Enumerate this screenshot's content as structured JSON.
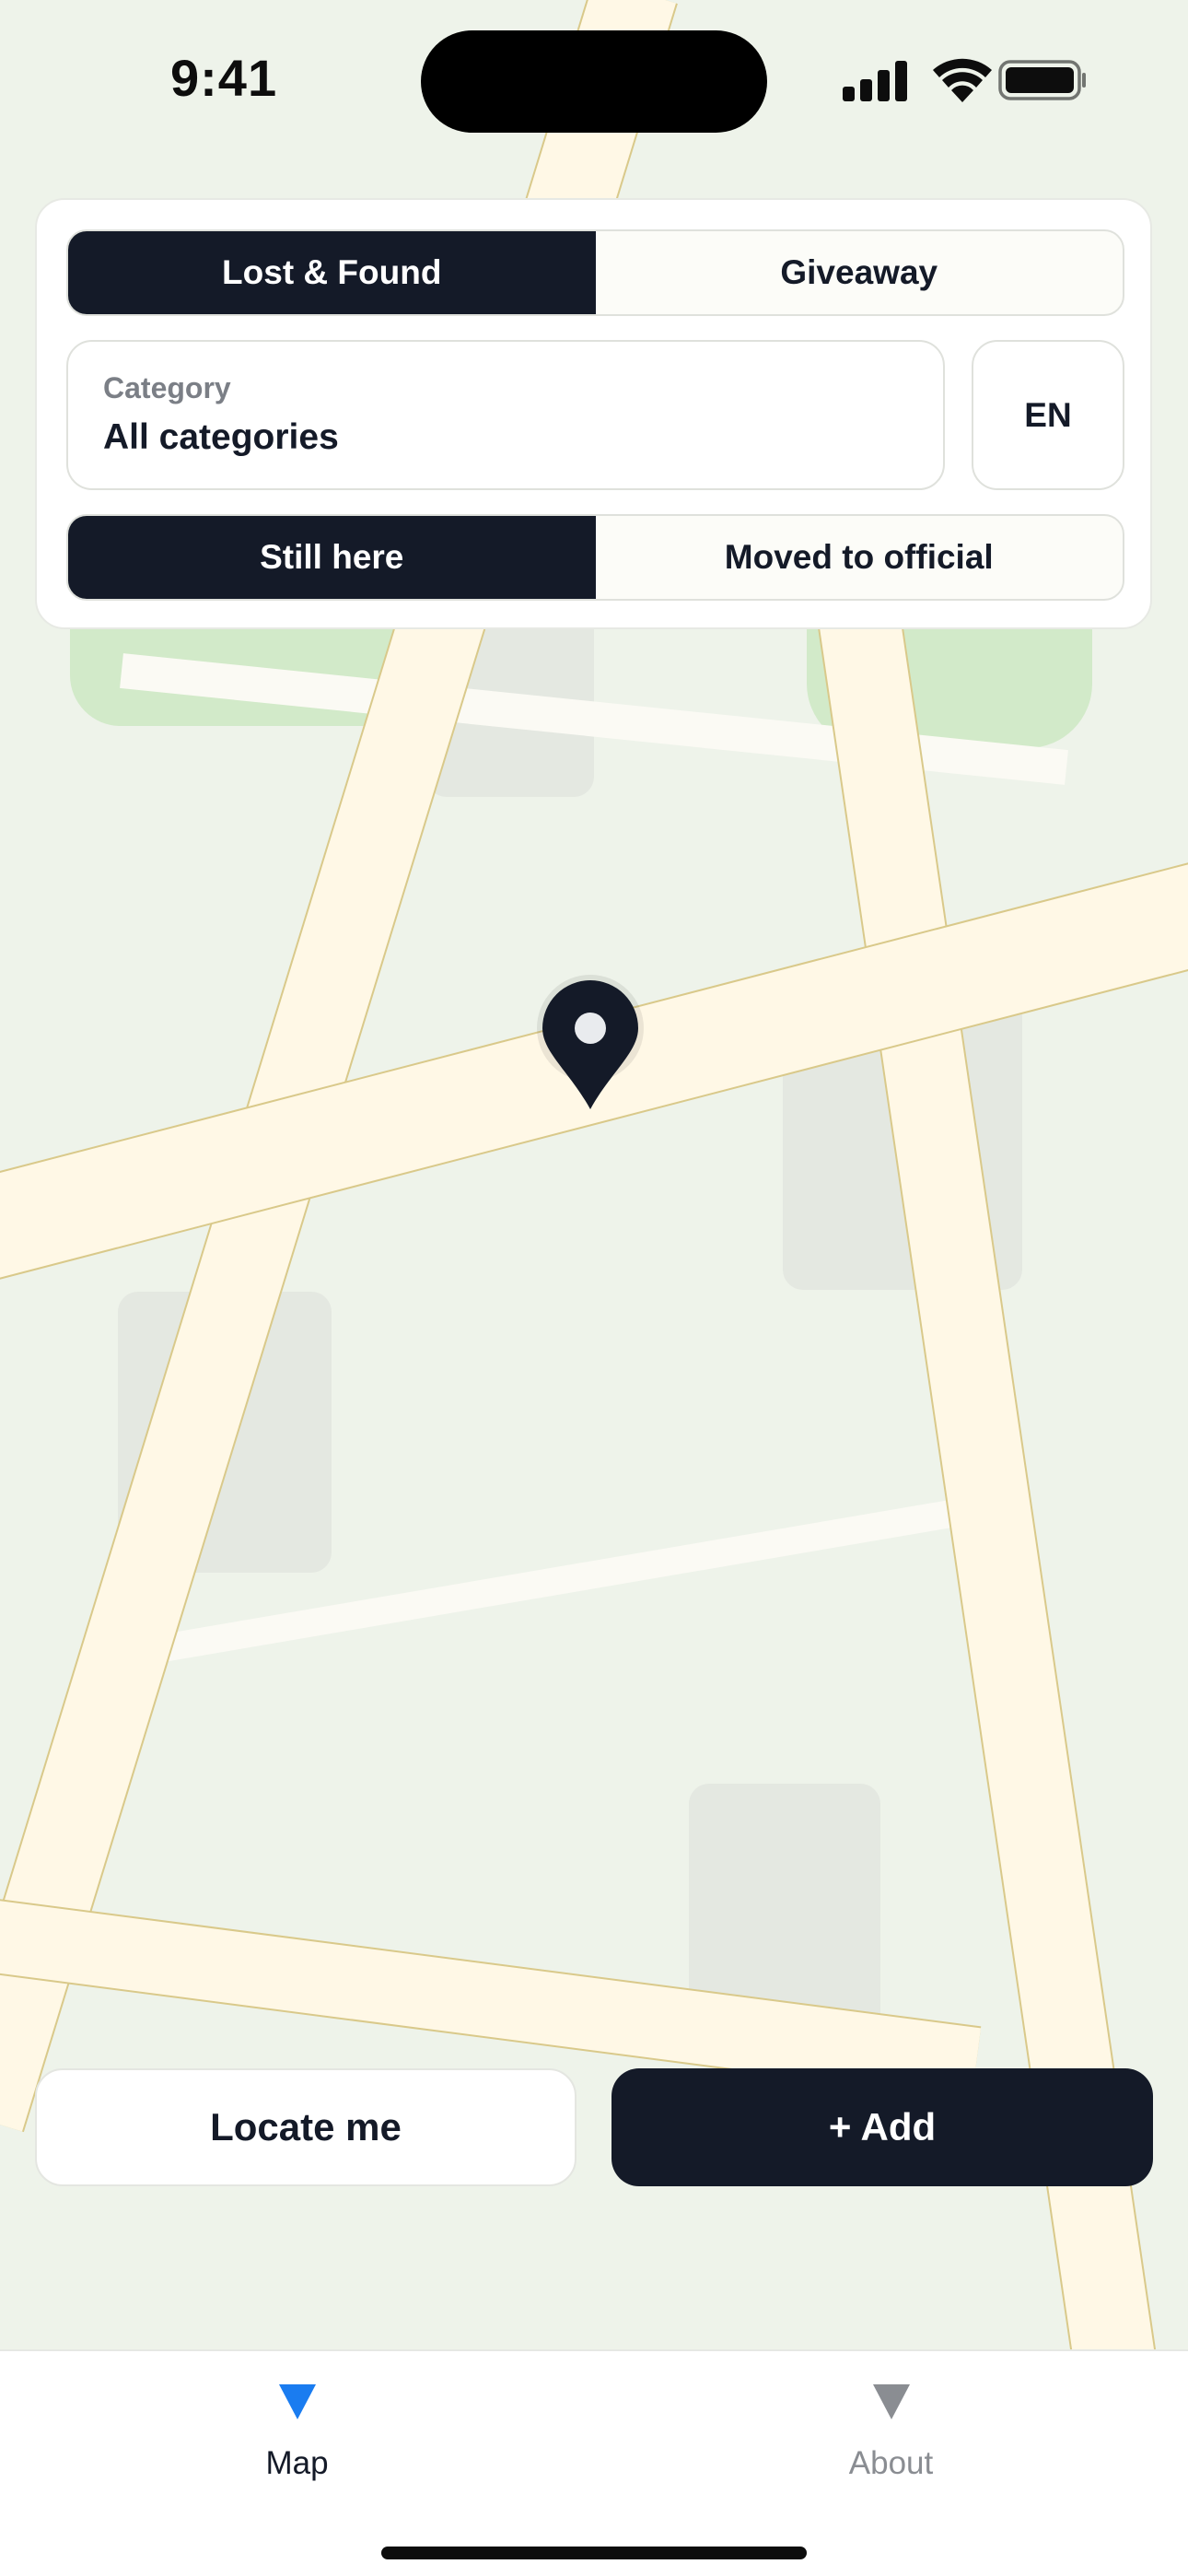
{
  "status_bar": {
    "time": "9:41"
  },
  "filters": {
    "mode_tabs": [
      {
        "label": "Lost & Found",
        "active": true
      },
      {
        "label": "Giveaway",
        "active": false
      }
    ],
    "category": {
      "label": "Category",
      "value": "All categories"
    },
    "language": "EN",
    "status_tabs": [
      {
        "label": "Still here",
        "active": true
      },
      {
        "label": "Moved to official",
        "active": false
      }
    ]
  },
  "actions": {
    "locate_label": "Locate me",
    "add_label": "+ Add"
  },
  "tab_bar": {
    "items": [
      {
        "label": "Map",
        "icon": "triangle-down-icon",
        "active": true
      },
      {
        "label": "About",
        "icon": "triangle-down-icon",
        "active": false
      }
    ]
  },
  "colors": {
    "accent": "#141a28",
    "active_tab_icon": "#1a7cf0",
    "inactive_tab": "#8a8d92",
    "map_background": "#eef3ea",
    "road_fill": "#fff8e6",
    "road_edge": "#d9c98a",
    "park": "#d2eac9"
  },
  "map": {
    "pin_icon": "map-pin-icon"
  }
}
